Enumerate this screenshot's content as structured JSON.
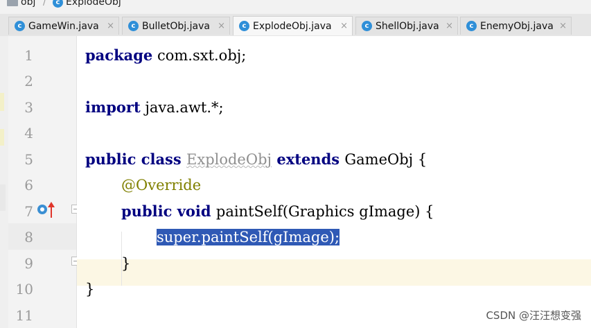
{
  "breadcrumb": {
    "folder": "obj",
    "file": "ExplodeObj"
  },
  "tabs": [
    {
      "label": "GameWin.java",
      "icon": "class-icon",
      "active": false
    },
    {
      "label": "BulletObj.java",
      "icon": "class-icon",
      "active": false
    },
    {
      "label": "ExplodeObj.java",
      "icon": "class-icon",
      "active": true
    },
    {
      "label": "ShellObj.java",
      "icon": "class-icon",
      "active": false
    },
    {
      "label": "EnemyObj.java",
      "icon": "class-icon",
      "active": false
    }
  ],
  "tab_close_glyph": "×",
  "class_icon_letter": "c",
  "line_numbers": [
    "1",
    "2",
    "3",
    "4",
    "5",
    "6",
    "7",
    "8",
    "9",
    "10",
    "11"
  ],
  "code": {
    "l1_kw": "package",
    "l1_rest": " com.sxt.obj;",
    "l3_kw": "import",
    "l3_rest": " java.awt.*;",
    "l5_kw1": "public class ",
    "l5_cls": "ExplodeObj",
    "l5_kw2": " extends ",
    "l5_rest": "GameObj {",
    "l6_ann": "@Override",
    "l7_kw": "public void ",
    "l7_rest": "paintSelf(Graphics gImage) {",
    "l8_kw": "super",
    "l8_rest": ".paintSelf(gImage);",
    "l9": "}",
    "l10": "}"
  },
  "watermark": "CSDN @汪汪想变强",
  "colors": {
    "keyword": "#000080",
    "annotation": "#808000",
    "selection": "#2f59b5",
    "current_line": "#fcf7e4"
  }
}
